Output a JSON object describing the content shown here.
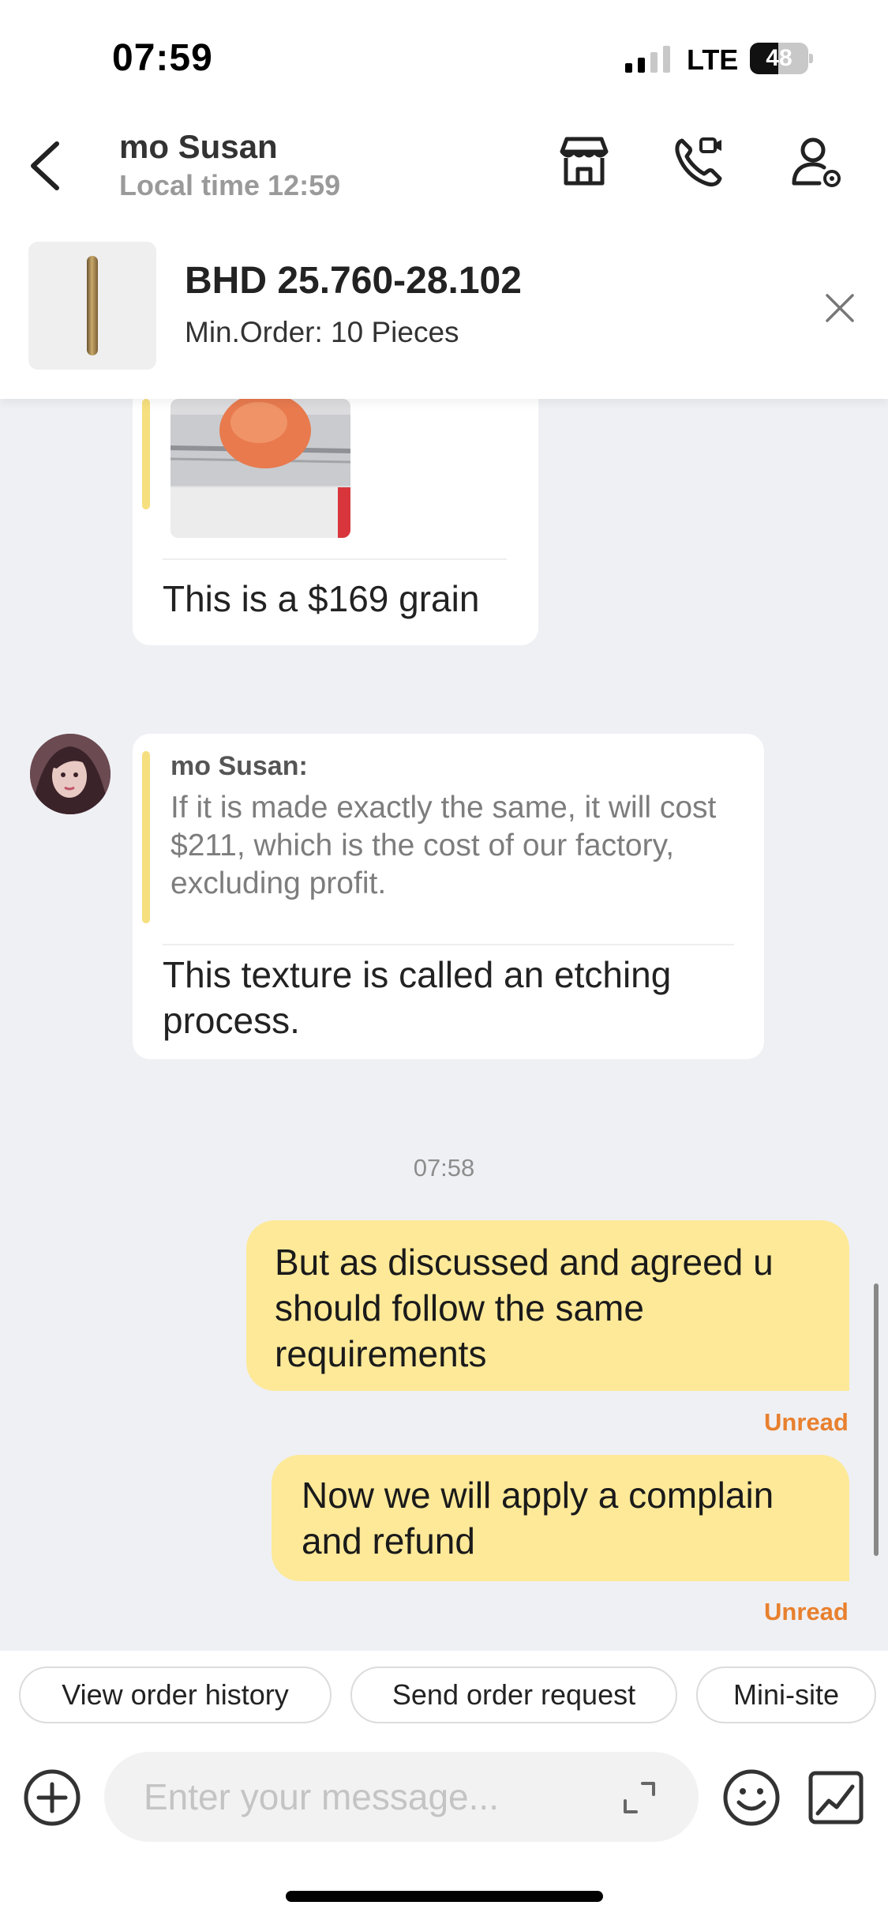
{
  "status_bar": {
    "time": "07:59",
    "network": "LTE",
    "battery": "48",
    "battery_level": 0.48
  },
  "header": {
    "contact_name": "mo Susan",
    "local_time": "Local time 12:59",
    "icons": [
      "back-icon",
      "store-icon",
      "video-call-icon",
      "contact-profile-icon"
    ]
  },
  "product": {
    "price": "BHD 25.760-28.102",
    "min_order": "Min.Order: 10 Pieces",
    "close_icon": "close-icon"
  },
  "messages": {
    "msg1": {
      "text": "This is a $169 grain"
    },
    "msg2": {
      "quote_author": "mo Susan:",
      "quote_text": "If it is made exactly the same, it will cost $211, which is the cost of our factory, excluding profit.",
      "text": "This texture is called an etching process."
    },
    "timestamp": "07:58",
    "out1": {
      "text": "But as discussed and agreed u should follow the same requirements",
      "status": "Unread"
    },
    "out2": {
      "text": "Now we will apply a complain and refund",
      "status": "Unread"
    }
  },
  "quick_actions": {
    "view_order_history": "View order history",
    "send_order_request": "Send order request",
    "mini_site": "Mini-site"
  },
  "composer": {
    "placeholder": "Enter your message...",
    "icons": [
      "plus-icon",
      "expand-icon",
      "emoji-icon",
      "image-icon"
    ]
  },
  "colors": {
    "outgoing_bubble": "#fde998",
    "unread": "#e8802e",
    "quote_bar": "#f6df7e",
    "chat_background": "#eff0f4"
  }
}
